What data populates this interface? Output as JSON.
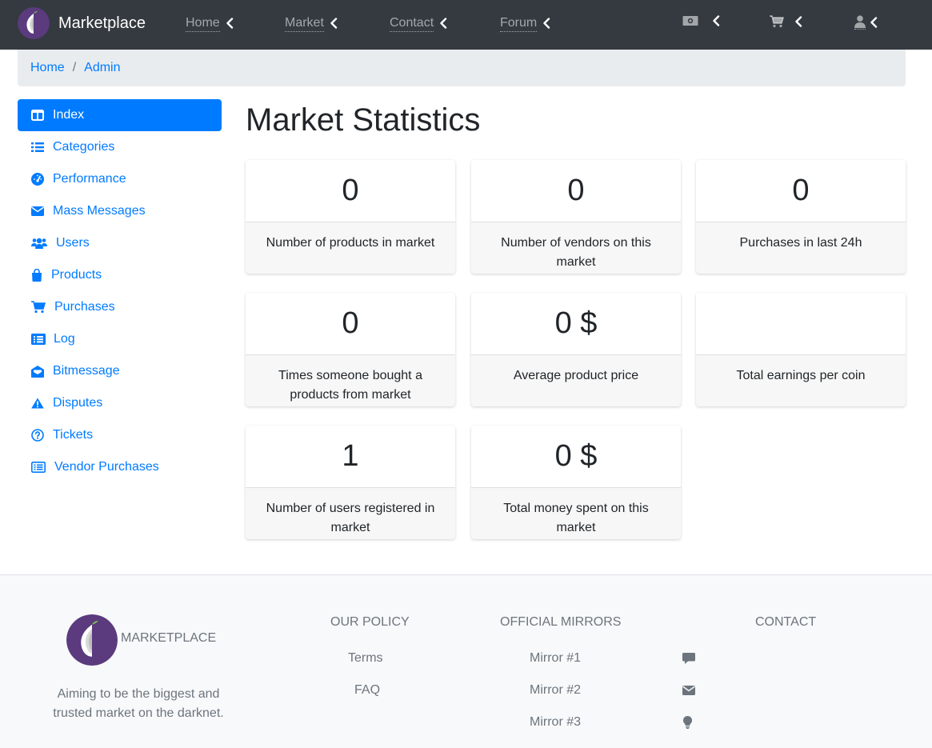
{
  "navbar": {
    "brand": "Marketplace",
    "items": [
      {
        "label": "Home"
      },
      {
        "label": "Market"
      },
      {
        "label": "Contact"
      },
      {
        "label": "Forum"
      }
    ],
    "icons": [
      "money-icon",
      "cart-icon",
      "user-icon"
    ]
  },
  "breadcrumb": {
    "home": "Home",
    "separator": "/",
    "current": "Admin"
  },
  "sidebar": {
    "items": [
      {
        "label": "Index",
        "icon": "columns-icon",
        "active": true
      },
      {
        "label": "Categories",
        "icon": "list-icon"
      },
      {
        "label": "Performance",
        "icon": "tachometer-icon"
      },
      {
        "label": "Mass Messages",
        "icon": "envelope-icon"
      },
      {
        "label": "Users",
        "icon": "users-icon"
      },
      {
        "label": "Products",
        "icon": "shopping-bag-icon"
      },
      {
        "label": "Purchases",
        "icon": "cart-icon"
      },
      {
        "label": "Log",
        "icon": "list-alt-icon"
      },
      {
        "label": "Bitmessage",
        "icon": "envelope-open-icon"
      },
      {
        "label": "Disputes",
        "icon": "warning-icon"
      },
      {
        "label": "Tickets",
        "icon": "question-circle-icon"
      },
      {
        "label": "Vendor Purchases",
        "icon": "list-alt-icon"
      }
    ]
  },
  "main": {
    "title": "Market Statistics",
    "stats": [
      {
        "value": "0",
        "label": "Number of products in market"
      },
      {
        "value": "0",
        "label": "Number of vendors on this market"
      },
      {
        "value": "0",
        "label": "Purchases in last 24h"
      },
      {
        "value": "0",
        "label": "Times someone bought a products from market"
      },
      {
        "value": "0 $",
        "label": "Average product price"
      },
      {
        "value": "",
        "label": "Total earnings per coin"
      },
      {
        "value": "1",
        "label": "Number of users registered in market"
      },
      {
        "value": "0 $",
        "label": "Total money spent on this market"
      }
    ]
  },
  "footer": {
    "brand": "MARKETPLACE",
    "tagline": "Aiming to be the biggest and trusted market on the darknet.",
    "policy_heading": "OUR POLICY",
    "policy_links": [
      "Terms",
      "FAQ"
    ],
    "mirrors_heading": "OFFICIAL MIRRORS",
    "mirrors": [
      "Mirror #1",
      "Mirror #2",
      "Mirror #3"
    ],
    "contact_heading": "CONTACT",
    "contact_icons": [
      "comment-icon",
      "envelope-icon",
      "lightbulb-icon"
    ]
  },
  "colors": {
    "navbar_bg": "#343a40",
    "primary": "#007bff",
    "breadcrumb_bg": "#e9ecef",
    "footer_bg": "#f8f9fa",
    "muted": "#6c757d",
    "logo_purple": "#5b3a7e"
  }
}
